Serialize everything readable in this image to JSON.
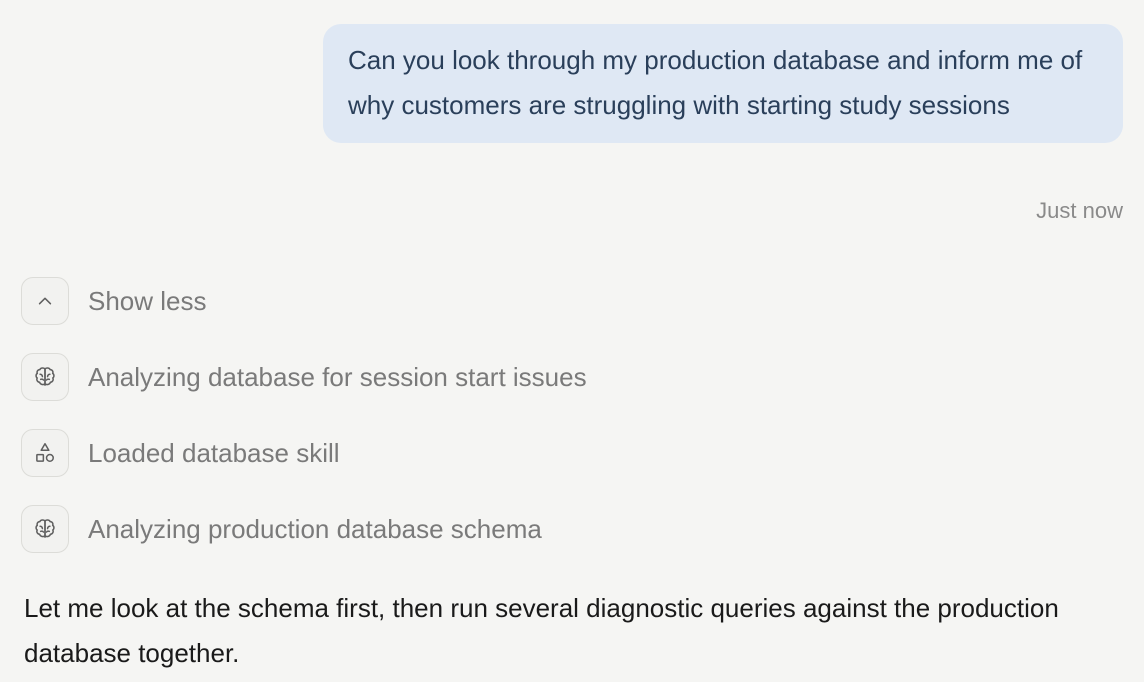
{
  "user_message": {
    "text": "Can you look through my production database and inform me of why customers are struggling with starting study sessions",
    "timestamp": "Just now"
  },
  "steps": [
    {
      "label": "Show less",
      "icon": "chevron-up-icon"
    },
    {
      "label": "Analyzing database for session start issues",
      "icon": "brain-icon"
    },
    {
      "label": "Loaded database skill",
      "icon": "shapes-icon"
    },
    {
      "label": "Analyzing production database schema",
      "icon": "brain-icon"
    }
  ],
  "assistant_message": {
    "text": "Let me look at the schema first, then run several diagnostic queries against the production database together."
  },
  "colors": {
    "background": "#f5f5f3",
    "user_bubble": "#dfe8f4",
    "user_text": "#2a3f5a",
    "step_text": "#7a7a7a"
  }
}
